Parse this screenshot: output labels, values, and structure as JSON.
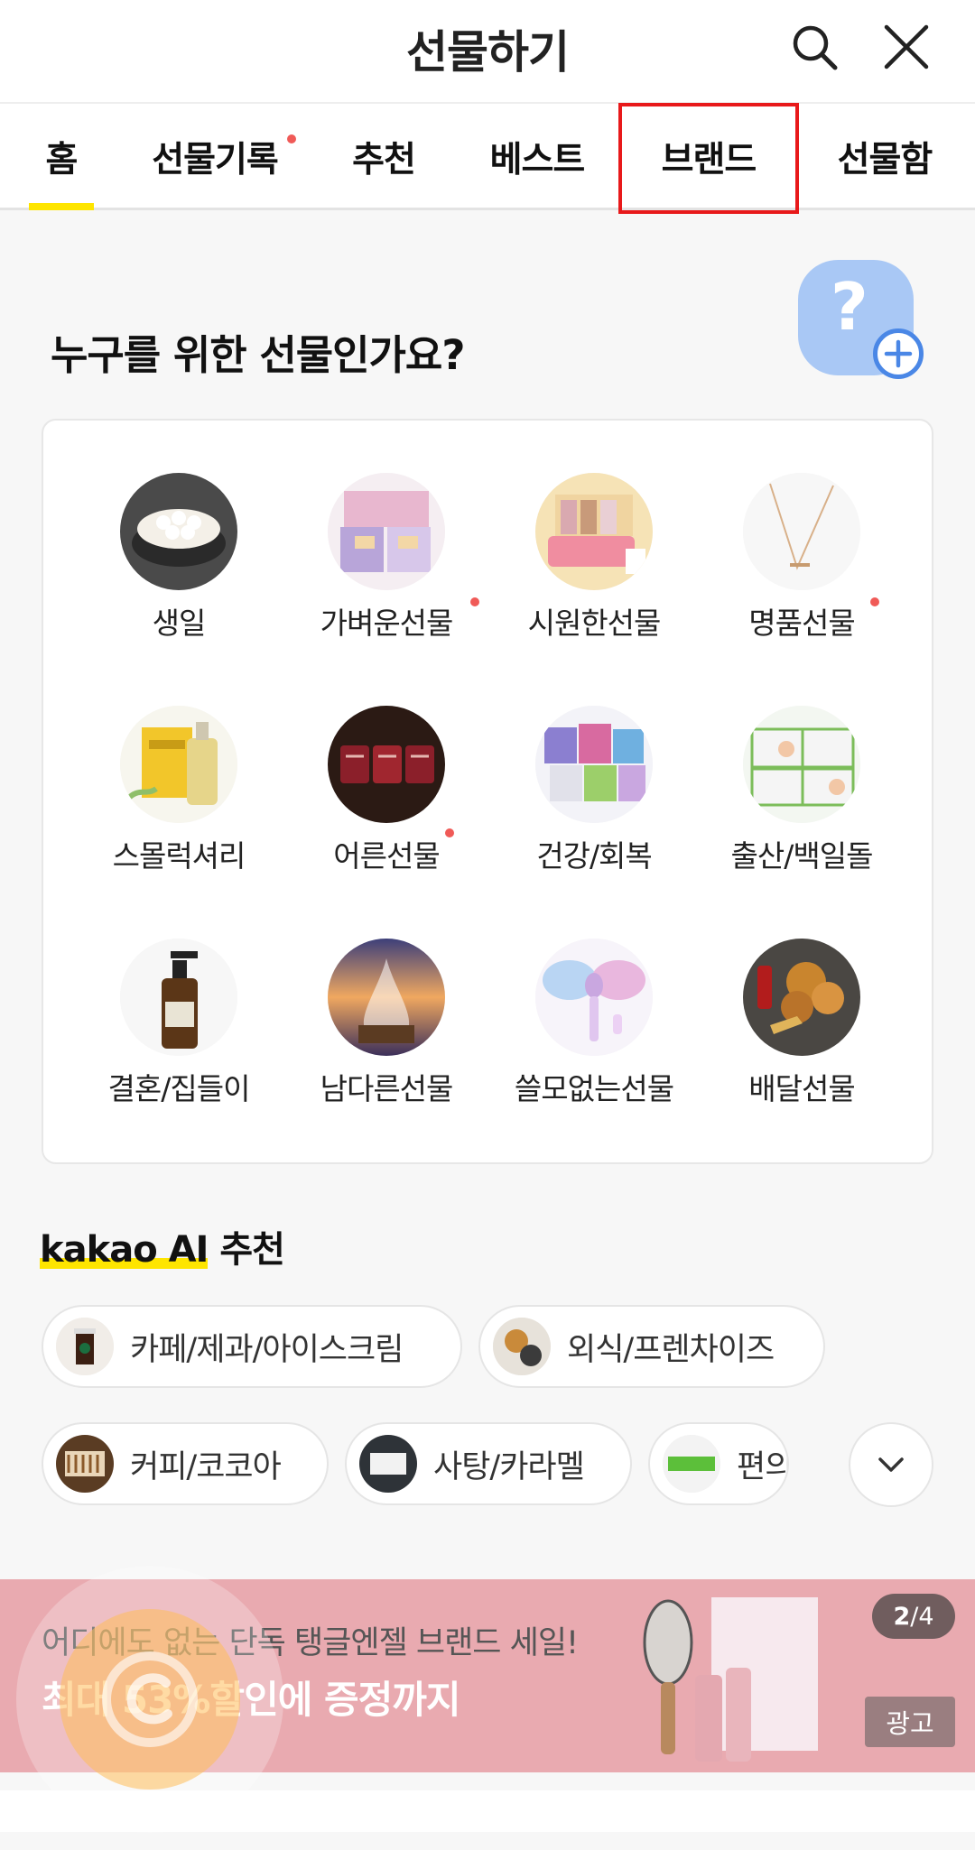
{
  "header": {
    "title": "선물하기",
    "search_icon": "search-icon",
    "close_icon": "close-icon"
  },
  "tabs": [
    {
      "label": "홈",
      "active": true,
      "new_dot": false
    },
    {
      "label": "선물기록",
      "active": false,
      "new_dot": true
    },
    {
      "label": "추천",
      "active": false,
      "new_dot": false
    },
    {
      "label": "베스트",
      "active": false,
      "new_dot": false
    },
    {
      "label": "브랜드",
      "active": false,
      "new_dot": false,
      "highlighted": true
    },
    {
      "label": "선물함",
      "active": false,
      "new_dot": false
    }
  ],
  "question": {
    "title": "누구를 위한 선물인가요?",
    "icon": "add-friend-question-icon",
    "mark": "?"
  },
  "categories": [
    {
      "label": "생일",
      "new_dot": false
    },
    {
      "label": "가벼운선물",
      "new_dot": true
    },
    {
      "label": "시원한선물",
      "new_dot": false
    },
    {
      "label": "명품선물",
      "new_dot": true
    },
    {
      "label": "스몰럭셔리",
      "new_dot": false
    },
    {
      "label": "어른선물",
      "new_dot": true
    },
    {
      "label": "건강/회복",
      "new_dot": false
    },
    {
      "label": "출산/백일돌",
      "new_dot": false
    },
    {
      "label": "결혼/집들이",
      "new_dot": false
    },
    {
      "label": "남다른선물",
      "new_dot": false
    },
    {
      "label": "쓸모없는선물",
      "new_dot": false
    },
    {
      "label": "배달선물",
      "new_dot": false
    }
  ],
  "ai": {
    "brand": "kakao AI",
    "title": "추천",
    "chips": [
      {
        "label": "카페/제과/아이스크림"
      },
      {
        "label": "외식/프렌차이즈"
      },
      {
        "label": "커피/코코아"
      },
      {
        "label": "사탕/카라멜"
      },
      {
        "label": "편의"
      }
    ],
    "expand_icon": "chevron-down-icon"
  },
  "banner": {
    "line1": "어디에도 없는 단독 탱글엔젤 브랜드 세일!",
    "line2": "최대 53%할인에 증정까지",
    "page_current": "2",
    "page_total": "/4",
    "ad_label": "광고"
  },
  "colors": {
    "accent": "#fee500",
    "new_dot": "#f05a57",
    "highlight": "#e8191a",
    "banner_bg": "#e9aab0"
  }
}
